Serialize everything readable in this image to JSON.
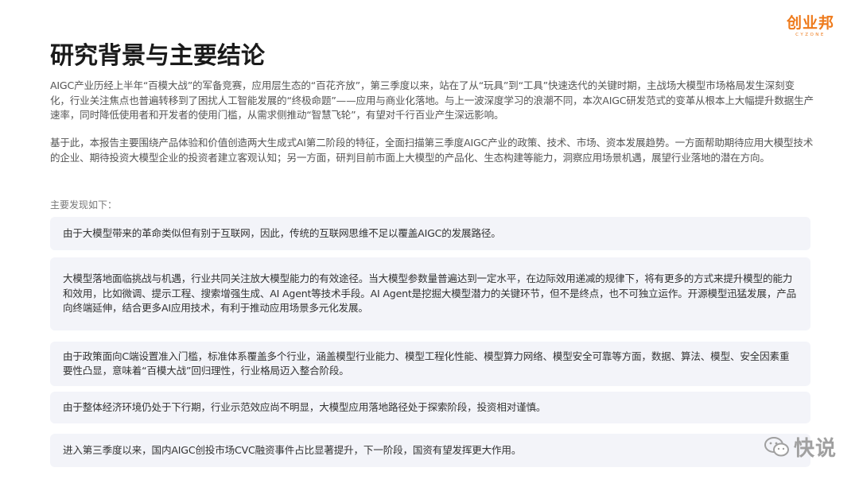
{
  "logo": {
    "main": "创业邦",
    "sub": "CYZONE"
  },
  "title": "研究背景与主要结论",
  "paragraphs": [
    "AIGC产业历经上半年“百模大战”的军备竞赛，应用层生态的“百花齐放”，第三季度以来，站在了从“玩具”到“工具”快速迭代的关键时期，主战场大模型市场格局发生深刻变化，行业关注焦点也普遍转移到了困扰人工智能发展的“终极命题”——应用与商业化落地。与上一波深度学习的浪潮不同，本次AIGC研发范式的变革从根本上大幅提升数据生产速率，同时降低使用者和开发者的使用门槛，从需求侧推动“智慧飞轮”，有望对千行百业产生深远影响。",
    "基于此，本报告主要围绕产品体验和价值创造两大生成式AI第二阶段的特征，全面扫描第三季度AIGC产业的政策、技术、市场、资本发展趋势。一方面帮助期待应用大模型技术的企业、期待投资大模型企业的投资者建立客观认知；另一方面，研判目前市面上大模型的产品化、生态构建等能力，洞察应用场景机遇，展望行业落地的潜在方向。"
  ],
  "findings_label": "主要发现如下：",
  "findings": [
    "由于大模型带来的革命类似但有别于互联网，因此，传统的互联网思维不足以覆盖AIGC的发展路径。",
    "大模型落地面临挑战与机遇，行业共同关注放大模型能力的有效途径。当大模型参数量普遍达到一定水平，在边际效用递减的规律下，将有更多的方式来提升模型的能力和效用，比如微调、提示工程、搜索增强生成、AI Agent等技术手段。AI Agent是挖掘大模型潜力的关键环节，但不是终点，也不可独立运作。开源模型迅猛发展，产品向终端延伸，结合更多AI应用技术，有利于推动应用场景多元化发展。",
    "由于政策面向C端设置准入门槛，标准体系覆盖多个行业，涵盖模型行业能力、模型工程化性能、模型算力网络、模型安全可靠等方面，数据、算法、模型、安全因素重要性凸显，意味着“百模大战”回归理性，行业格局迈入整合阶段。",
    "由于整体经济环境仍处于下行期，行业示范效应尚不明显，大模型应用落地路径处于探索阶段，投资相对谨慎。",
    "进入第三季度以来，国内AIGC创投市场CVC融资事件占比显著提升，下一阶段，国资有望发挥更大作用。"
  ],
  "watermark": {
    "text": "快说"
  },
  "colors": {
    "brand_orange": "#ee7a1b",
    "card_bg": "#f3f4f9",
    "title": "#1a1a1a",
    "body": "#555555"
  }
}
